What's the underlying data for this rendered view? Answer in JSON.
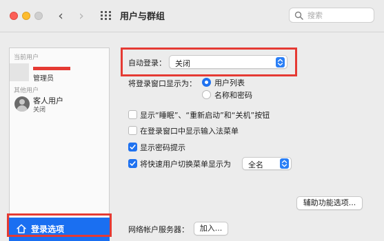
{
  "window": {
    "title": "用户与群组"
  },
  "search": {
    "placeholder": "搜索"
  },
  "sidebar": {
    "current_users_label": "当前用户",
    "current_user_role": "管理员",
    "other_users_label": "其他用户",
    "guest": {
      "name": "客人用户",
      "status": "关闭"
    },
    "login_options_label": "登录选项"
  },
  "main": {
    "auto_login": {
      "label": "自动登录：",
      "value": "关闭"
    },
    "display_as": {
      "label": "将登录窗口显示为：",
      "options": [
        {
          "label": "用户列表",
          "selected": true
        },
        {
          "label": "名称和密码",
          "selected": false
        }
      ]
    },
    "checkboxes": [
      {
        "label": "显示“睡眠”、“重新启动”和“关机”按钮",
        "checked": false
      },
      {
        "label": "在登录窗口中显示输入法菜单",
        "checked": false
      },
      {
        "label": "显示密码提示",
        "checked": true
      },
      {
        "label": "将快速用户切换菜单显示为",
        "checked": true
      }
    ],
    "fast_switch_value": "全名",
    "accessibility_button": "辅助功能选项...",
    "network_server": {
      "label": "网络帐户服务器：",
      "button": "加入..."
    }
  },
  "colors": {
    "accent": "#1f72f0",
    "highlight": "#e53a33",
    "selection": "#1a6ff1"
  }
}
